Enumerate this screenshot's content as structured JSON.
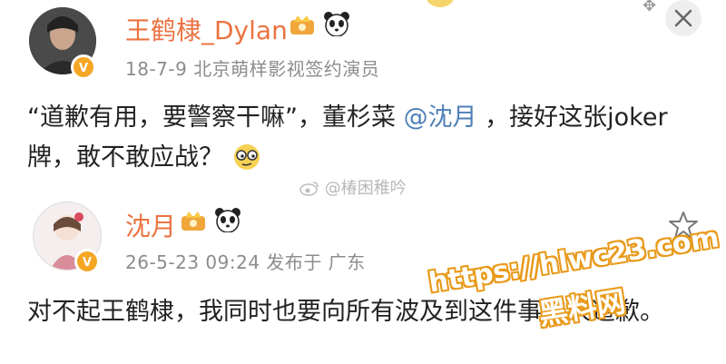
{
  "post1": {
    "username": "王鹤棣_Dylan",
    "meta": "18-7-9  北京萌样影视签约演员",
    "content_before": "“道歉有用，要警察干嘛”，董杉菜 ",
    "mention": "@沈月",
    "content_after": " ，接好这张joker牌，敢不敢应战？",
    "avatar": "user-photo",
    "verify_icon": "verified-icon",
    "emoji_icon": "smirk-face-icon"
  },
  "watermark": "@椿困稚吟",
  "post2": {
    "username": "沈月",
    "meta": "26-5-23 09:24  发布于 广东",
    "content": "对不起王鹤棣，我同时也要向所有波及到这件事的人道歉。",
    "avatar": "user-illustration",
    "verify_icon": "verified-icon"
  },
  "overlay": {
    "url": "https://hlwc23.com",
    "name": "黑料网"
  },
  "icons": {
    "close": "close-icon",
    "star": "star-icon",
    "crown": "crown-badge-icon",
    "panda": "panda-icon"
  },
  "colors": {
    "username": "#eb7340",
    "mention": "#4e7fb8",
    "meta": "#8c8c8c",
    "overlay_stroke": "#e89a1a"
  }
}
